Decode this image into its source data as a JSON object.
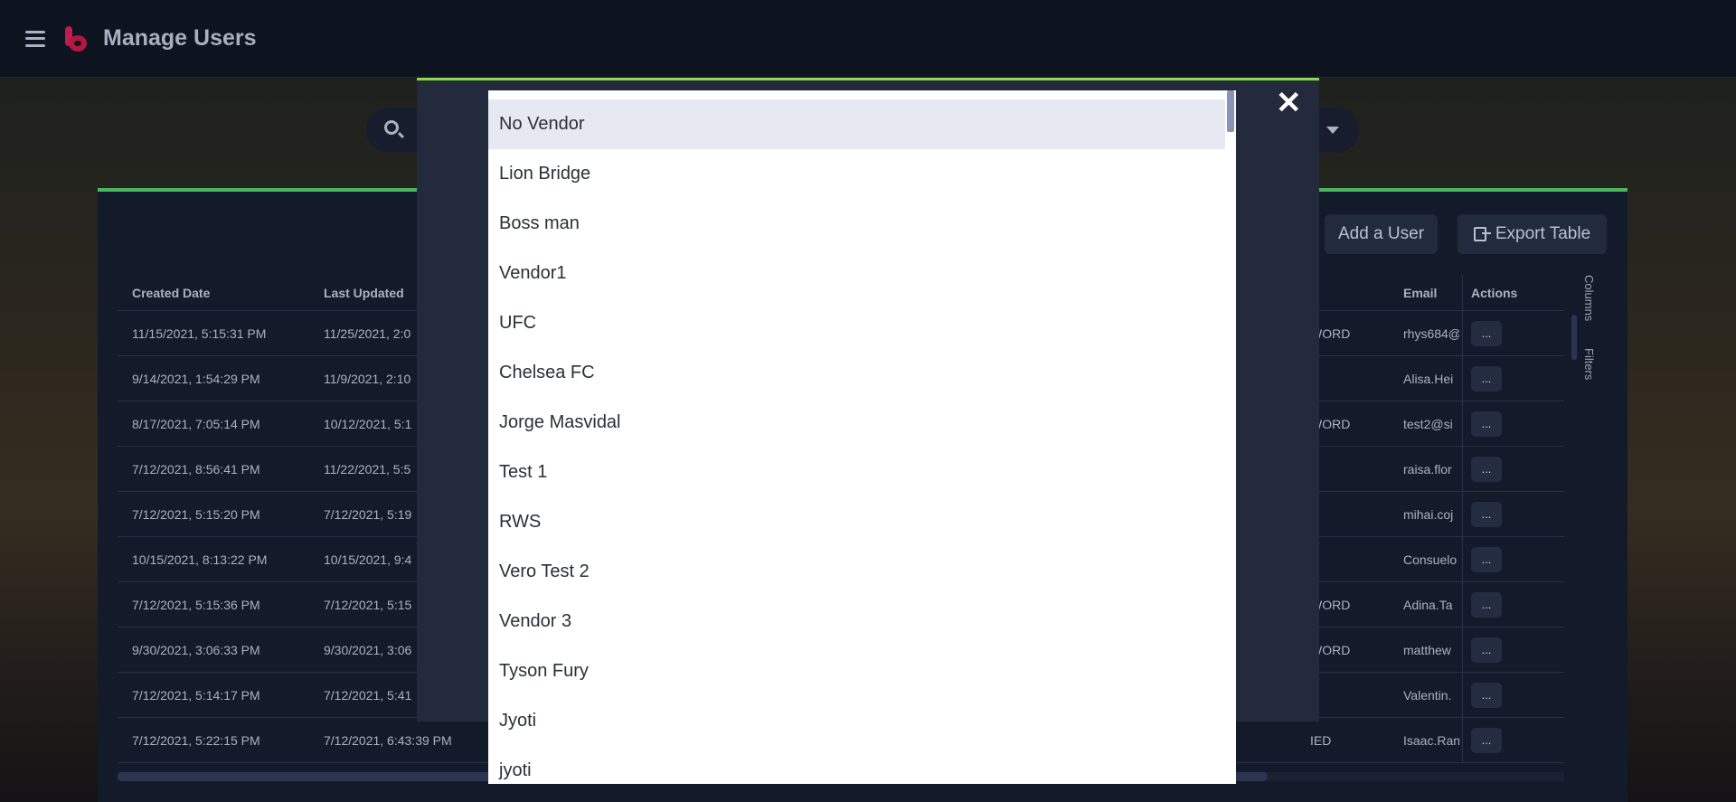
{
  "app": {
    "title": "Manage Users"
  },
  "toolbar": {
    "add_user": "Add a User",
    "export_table": "Export Table"
  },
  "table": {
    "headers": {
      "created": "Created Date",
      "updated": "Last Updated",
      "email": "Email",
      "actions": "Actions"
    },
    "rows": [
      {
        "created": "11/15/2021, 5:15:31 PM",
        "updated": "11/25/2021, 2:0",
        "role": "WORD",
        "email": "rhys684@",
        "action": "..."
      },
      {
        "created": "9/14/2021, 1:54:29 PM",
        "updated": "11/9/2021, 2:10",
        "role": "",
        "email": "Alisa.Hei",
        "action": "..."
      },
      {
        "created": "8/17/2021, 7:05:14 PM",
        "updated": "10/12/2021, 5:1",
        "role": "WORD",
        "email": "test2@si",
        "action": "..."
      },
      {
        "created": "7/12/2021, 8:56:41 PM",
        "updated": "11/22/2021, 5:5",
        "role": "",
        "email": "raisa.flor",
        "action": "..."
      },
      {
        "created": "7/12/2021, 5:15:20 PM",
        "updated": "7/12/2021, 5:19",
        "role": "",
        "email": "mihai.coj",
        "action": "..."
      },
      {
        "created": "10/15/2021, 8:13:22 PM",
        "updated": "10/15/2021, 9:4",
        "role": "",
        "email": "Consuelo",
        "action": "..."
      },
      {
        "created": "7/12/2021, 5:15:36 PM",
        "updated": "7/12/2021, 5:15",
        "role": "WORD",
        "email": "Adina.Ta",
        "action": "..."
      },
      {
        "created": "9/30/2021, 3:06:33 PM",
        "updated": "9/30/2021, 3:06",
        "role": "WORD",
        "email": "matthew",
        "action": "..."
      },
      {
        "created": "7/12/2021, 5:14:17 PM",
        "updated": "7/12/2021, 5:41",
        "role": "",
        "email": "Valentin.",
        "action": "..."
      },
      {
        "created": "7/12/2021, 5:22:15 PM",
        "updated": "7/12/2021, 6:43:39 PM",
        "role": "IED",
        "email": "Isaac.Ran",
        "action": "..."
      }
    ]
  },
  "side_tabs": {
    "columns": "Columns",
    "filters": "Filters"
  },
  "dropdown": {
    "close": "✕",
    "items": [
      "No Vendor",
      "Lion Bridge",
      "Boss man",
      "Vendor1",
      "UFC",
      "Chelsea FC",
      "Jorge Masvidal",
      "Test 1",
      "RWS",
      "Vero Test 2",
      "Vendor 3",
      "Tyson Fury",
      "Jyoti",
      "jyoti"
    ],
    "selected_index": 0
  }
}
